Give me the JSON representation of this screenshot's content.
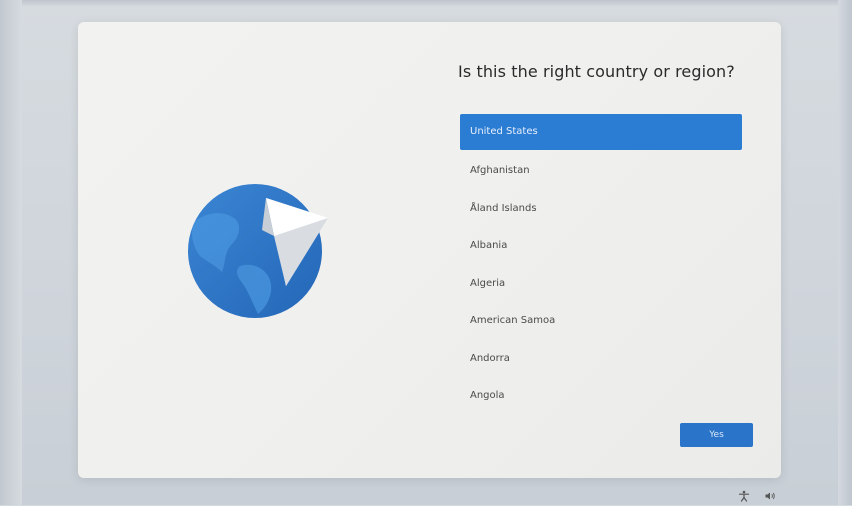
{
  "setup": {
    "title": "Is this the right country or region?",
    "countries": [
      "United States",
      "Afghanistan",
      "Åland Islands",
      "Albania",
      "Algeria",
      "American Samoa",
      "Andorra",
      "Angola"
    ],
    "selected": "United States",
    "yes_label": "Yes"
  },
  "taskbar": {
    "icons": [
      "accessibility-icon",
      "volume-icon"
    ]
  },
  "colors": {
    "accent": "#2b7cd3",
    "globe": "#2f79c8",
    "card": "#f0f0ee"
  }
}
